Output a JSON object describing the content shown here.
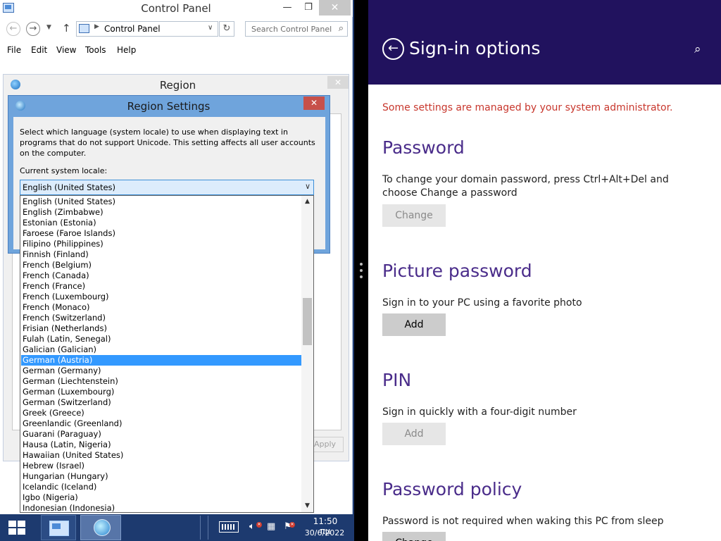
{
  "control_panel": {
    "title": "Control Panel",
    "address": "Control Panel",
    "search_placeholder": "Search Control Panel",
    "menu": [
      "File",
      "Edit",
      "View",
      "Tools",
      "Help"
    ]
  },
  "region_dialog": {
    "title": "Region",
    "apply_label": "Apply"
  },
  "region_settings": {
    "title": "Region Settings",
    "description": "Select which language (system locale) to use when displaying text in programs that do not support Unicode. This setting affects all user accounts on the computer.",
    "locale_label": "Current system locale:",
    "selected_locale": "English (United States)",
    "locale_options": [
      "English (United States)",
      "English (Zimbabwe)",
      "Estonian (Estonia)",
      "Faroese (Faroe Islands)",
      "Filipino (Philippines)",
      "Finnish (Finland)",
      "French (Belgium)",
      "French (Canada)",
      "French (France)",
      "French (Luxembourg)",
      "French (Monaco)",
      "French (Switzerland)",
      "Frisian (Netherlands)",
      "Fulah (Latin, Senegal)",
      "Galician (Galician)",
      "German (Austria)",
      "German (Germany)",
      "German (Liechtenstein)",
      "German (Luxembourg)",
      "German (Switzerland)",
      "Greek (Greece)",
      "Greenlandic (Greenland)",
      "Guarani (Paraguay)",
      "Hausa (Latin, Nigeria)",
      "Hawaiian (United States)",
      "Hebrew (Israel)",
      "Hungarian (Hungary)",
      "Icelandic (Iceland)",
      "Igbo (Nigeria)",
      "Indonesian (Indonesia)"
    ],
    "highlighted_option": "German (Austria)"
  },
  "taskbar": {
    "time": "11:50 πμ",
    "date": "30/6/2022"
  },
  "sign_in": {
    "title": "Sign-in options",
    "admin_notice": "Some settings are managed by your system administrator.",
    "sections": [
      {
        "heading": "Password",
        "description": "To change your domain password, press Ctrl+Alt+Del and choose Change a password",
        "button": "Change",
        "button_enabled": false
      },
      {
        "heading": "Picture password",
        "description": "Sign in to your PC using a favorite photo",
        "button": "Add",
        "button_enabled": true
      },
      {
        "heading": "PIN",
        "description": "Sign in quickly with a four-digit number",
        "button": "Add",
        "button_enabled": false
      },
      {
        "heading": "Password policy",
        "description": "Password is not required when waking this PC from sleep",
        "button": "Change",
        "button_enabled": true
      }
    ]
  },
  "colors": {
    "settings_header": "#21125e",
    "section_heading": "#4a2c8a",
    "admin_notice": "#c8372d",
    "list_highlight": "#3399ff",
    "taskbar": "#1d3a6f"
  },
  "icons": [
    "control-panel-icon",
    "back-arrow-icon",
    "forward-arrow-icon",
    "up-arrow-icon",
    "refresh-icon",
    "search-icon",
    "globe-icon",
    "close-icon",
    "windows-logo-icon",
    "keyboard-icon",
    "speaker-icon",
    "network-icon",
    "action-center-flag-icon",
    "back-circle-icon"
  ]
}
